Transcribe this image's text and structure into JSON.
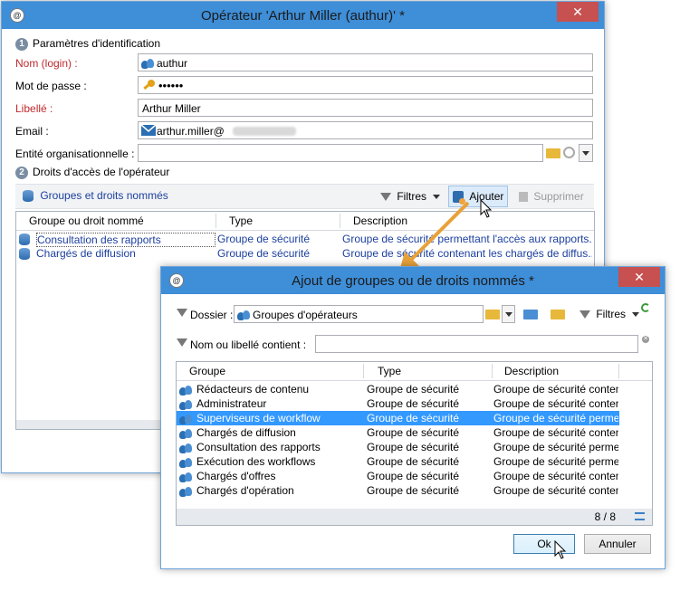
{
  "main_window": {
    "title": "Opérateur 'Arthur Miller (authur)' *",
    "close": "✕",
    "section1": {
      "num": "1",
      "title": "Paramètres d'identification"
    },
    "fields": {
      "login_label": "Nom (login) :",
      "login_value": "authur",
      "password_label": "Mot de passe :",
      "password_value": "••••••",
      "libelle_label": "Libellé :",
      "libelle_value": "Arthur Miller",
      "email_label": "Email :",
      "email_value": "arthur.miller@",
      "entite_label": "Entité organisationnelle :",
      "entite_value": ""
    },
    "section2": {
      "num": "2",
      "title": "Droits d'accès de l'opérateur"
    },
    "toolbar": {
      "groups_label": "Groupes et droits nommés",
      "filters_label": "Filtres",
      "add_label": "Ajouter",
      "delete_label": "Supprimer"
    },
    "grid": {
      "headers": [
        "Groupe ou droit nommé",
        "Type",
        "Description"
      ],
      "rows": [
        [
          "Consultation des rapports",
          "Groupe de sécurité",
          "Groupe de sécurité permettant l'accès aux rapports..."
        ],
        [
          "Chargés de diffusion",
          "Groupe de sécurité",
          "Groupe de sécurité contenant les chargés de diffus..."
        ]
      ]
    }
  },
  "dialog": {
    "title": "Ajout de groupes ou de droits nommés *",
    "close": "✕",
    "folder_label": "Dossier :",
    "folder_value": "Groupes d'opérateurs",
    "filters_label": "Filtres",
    "search_label": "Nom ou libellé contient :",
    "search_value": "",
    "grid": {
      "headers": [
        "Groupe",
        "Type",
        "Description"
      ],
      "rows": [
        [
          "Rédacteurs de contenu",
          "Groupe de sécurité",
          "Groupe de sécurité contenant l..."
        ],
        [
          "Administrateur",
          "Groupe de sécurité",
          "Groupe de sécurité contenant les"
        ],
        [
          "Superviseurs de workflow",
          "Groupe de sécurité",
          "Groupe de sécurité permettant..."
        ],
        [
          "Chargés de diffusion",
          "Groupe de sécurité",
          "Groupe de sécurité contenant l..."
        ],
        [
          "Consultation des rapports",
          "Groupe de sécurité",
          "Groupe de sécurité permettant l..."
        ],
        [
          "Exécution des workflows",
          "Groupe de sécurité",
          "Groupe de sécurité permettant l..."
        ],
        [
          "Chargés d'offres",
          "Groupe de sécurité",
          "Groupe de sécurité contenant l..."
        ],
        [
          "Chargés d'opération",
          "Groupe de sécurité",
          "Groupe de sécurité contenan..."
        ]
      ],
      "selected_index": 2,
      "count": "8 / 8"
    },
    "ok_label": "Ok",
    "cancel_label": "Annuler"
  },
  "colors": {
    "titlebar": "#3e8ed8",
    "close": "#c75050",
    "selection": "#3399ff",
    "arrow": "#e8a23a",
    "required_label": "#c0282d"
  }
}
